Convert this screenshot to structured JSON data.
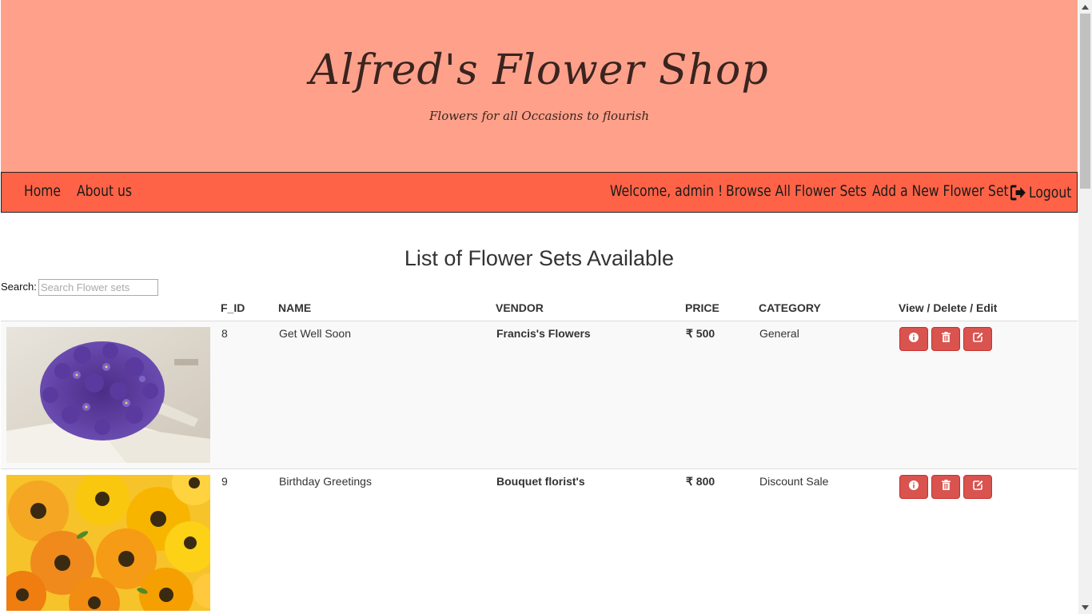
{
  "header": {
    "title": "Alfred's Flower Shop",
    "tagline": "Flowers for all Occasions to flourish",
    "bg_color": "#ffa18a"
  },
  "nav": {
    "home": "Home",
    "about": "About us",
    "welcome": "Welcome, admin !",
    "browse": "Browse All Flower Sets",
    "add": "Add a New Flower Set",
    "logout": "Logout",
    "bg_color": "#ff6347"
  },
  "main": {
    "heading": "List of Flower Sets Available",
    "search_label": "Search:",
    "search_placeholder": "Search Flower sets",
    "search_value": ""
  },
  "table": {
    "columns": [
      "F_ID",
      "NAME",
      "VENDOR",
      "PRICE",
      "CATEGORY",
      "View / Delete / Edit"
    ],
    "rows": [
      {
        "image": "purple-violets-bouquet",
        "f_id": "8",
        "name": "Get Well Soon",
        "vendor": "Francis's Flowers",
        "price": "₹ 500",
        "category": "General"
      },
      {
        "image": "orange-yellow-gerberas",
        "f_id": "9",
        "name": "Birthday Greetings",
        "vendor": "Bouquet florist's",
        "price": "₹ 800",
        "category": "Discount Sale"
      }
    ],
    "button_color": "#d9534f"
  },
  "icons": {
    "view": "info-icon",
    "delete": "trash-icon",
    "edit": "edit-icon",
    "logout": "logout-icon"
  }
}
